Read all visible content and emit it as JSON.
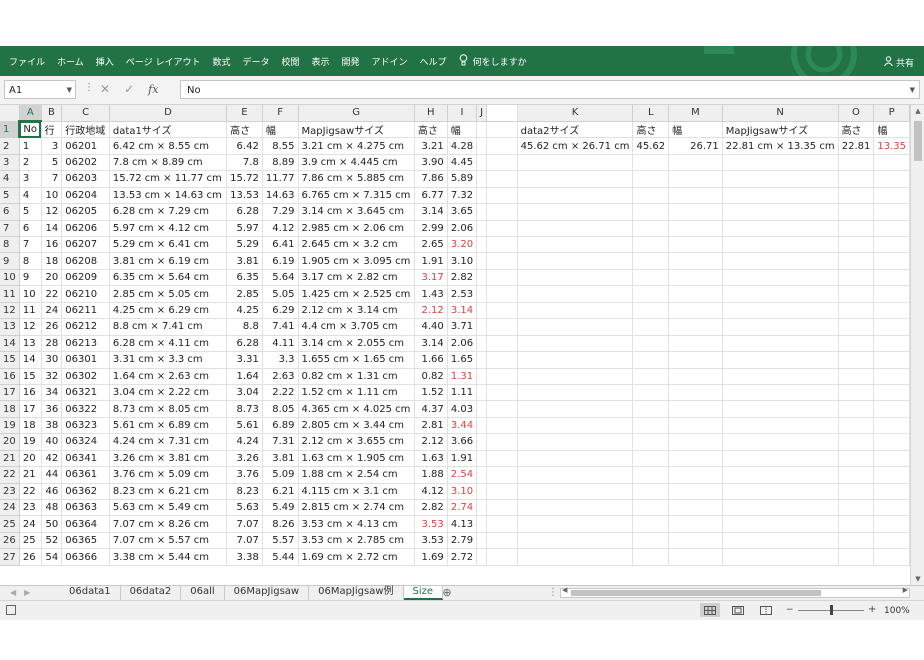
{
  "ribbon": {
    "tabs": [
      "ファイル",
      "ホーム",
      "挿入",
      "ページ レイアウト",
      "数式",
      "データ",
      "校閲",
      "表示",
      "開発",
      "アドイン",
      "ヘルプ"
    ],
    "tell_me": "何をしますか",
    "share": "共有"
  },
  "formula_bar": {
    "name_box": "A1",
    "fx": "fx",
    "content": "No"
  },
  "columns": [
    "A",
    "B",
    "C",
    "D",
    "E",
    "F",
    "G",
    "H",
    "I",
    "J",
    "K",
    "L",
    "M",
    "N",
    "O",
    "P"
  ],
  "header_row": [
    "No",
    "行",
    "行政地域",
    "data1サイズ",
    "高さ",
    "幅",
    "MapJigsawサイズ",
    "高さ",
    "幅",
    "",
    "data2サイズ",
    "高さ",
    "幅",
    "MapJigsawサイズ",
    "高さ",
    "幅"
  ],
  "rows": [
    [
      "1",
      "3",
      "06201",
      "6.42 cm × 8.55 cm",
      "6.42",
      "8.55",
      "3.21 cm × 4.275 cm",
      "3.21",
      "4.28",
      "",
      "45.62 cm × 26.71 cm",
      "45.62",
      "26.71",
      "22.81 cm × 13.35 cm",
      "22.81",
      "13.35"
    ],
    [
      "2",
      "5",
      "06202",
      "7.8 cm × 8.89 cm",
      "7.8",
      "8.89",
      "3.9 cm × 4.445 cm",
      "3.90",
      "4.45",
      "",
      "",
      "",
      "",
      "",
      "",
      ""
    ],
    [
      "3",
      "7",
      "06203",
      "15.72 cm × 11.77 cm",
      "15.72",
      "11.77",
      "7.86 cm × 5.885 cm",
      "7.86",
      "5.89",
      "",
      "",
      "",
      "",
      "",
      "",
      ""
    ],
    [
      "4",
      "10",
      "06204",
      "13.53 cm × 14.63 cm",
      "13.53",
      "14.63",
      "6.765 cm × 7.315 cm",
      "6.77",
      "7.32",
      "",
      "",
      "",
      "",
      "",
      "",
      ""
    ],
    [
      "5",
      "12",
      "06205",
      "6.28 cm × 7.29 cm",
      "6.28",
      "7.29",
      "3.14 cm × 3.645 cm",
      "3.14",
      "3.65",
      "",
      "",
      "",
      "",
      "",
      "",
      ""
    ],
    [
      "6",
      "14",
      "06206",
      "5.97 cm × 4.12 cm",
      "5.97",
      "4.12",
      "2.985 cm × 2.06 cm",
      "2.99",
      "2.06",
      "",
      "",
      "",
      "",
      "",
      "",
      ""
    ],
    [
      "7",
      "16",
      "06207",
      "5.29 cm × 6.41 cm",
      "5.29",
      "6.41",
      "2.645 cm × 3.2 cm",
      "2.65",
      "3.20",
      "",
      "",
      "",
      "",
      "",
      "",
      ""
    ],
    [
      "8",
      "18",
      "06208",
      "3.81 cm × 6.19 cm",
      "3.81",
      "6.19",
      "1.905 cm × 3.095 cm",
      "1.91",
      "3.10",
      "",
      "",
      "",
      "",
      "",
      "",
      ""
    ],
    [
      "9",
      "20",
      "06209",
      "6.35 cm × 5.64 cm",
      "6.35",
      "5.64",
      "3.17 cm × 2.82 cm",
      "3.17",
      "2.82",
      "",
      "",
      "",
      "",
      "",
      "",
      ""
    ],
    [
      "10",
      "22",
      "06210",
      "2.85 cm × 5.05 cm",
      "2.85",
      "5.05",
      "1.425 cm × 2.525 cm",
      "1.43",
      "2.53",
      "",
      "",
      "",
      "",
      "",
      "",
      ""
    ],
    [
      "11",
      "24",
      "06211",
      "4.25 cm × 6.29 cm",
      "4.25",
      "6.29",
      "2.12 cm × 3.14 cm",
      "2.12",
      "3.14",
      "",
      "",
      "",
      "",
      "",
      "",
      ""
    ],
    [
      "12",
      "26",
      "06212",
      "8.8 cm × 7.41 cm",
      "8.8",
      "7.41",
      "4.4 cm × 3.705 cm",
      "4.40",
      "3.71",
      "",
      "",
      "",
      "",
      "",
      "",
      ""
    ],
    [
      "13",
      "28",
      "06213",
      "6.28 cm × 4.11 cm",
      "6.28",
      "4.11",
      "3.14 cm × 2.055 cm",
      "3.14",
      "2.06",
      "",
      "",
      "",
      "",
      "",
      "",
      ""
    ],
    [
      "14",
      "30",
      "06301",
      "3.31 cm × 3.3 cm",
      "3.31",
      "3.3",
      "1.655 cm × 1.65 cm",
      "1.66",
      "1.65",
      "",
      "",
      "",
      "",
      "",
      "",
      ""
    ],
    [
      "15",
      "32",
      "06302",
      "1.64 cm × 2.63 cm",
      "1.64",
      "2.63",
      "0.82 cm × 1.31 cm",
      "0.82",
      "1.31",
      "",
      "",
      "",
      "",
      "",
      "",
      ""
    ],
    [
      "16",
      "34",
      "06321",
      "3.04 cm × 2.22 cm",
      "3.04",
      "2.22",
      "1.52 cm × 1.11 cm",
      "1.52",
      "1.11",
      "",
      "",
      "",
      "",
      "",
      "",
      ""
    ],
    [
      "17",
      "36",
      "06322",
      "8.73 cm × 8.05 cm",
      "8.73",
      "8.05",
      "4.365 cm × 4.025 cm",
      "4.37",
      "4.03",
      "",
      "",
      "",
      "",
      "",
      "",
      ""
    ],
    [
      "18",
      "38",
      "06323",
      "5.61 cm × 6.89 cm",
      "5.61",
      "6.89",
      "2.805 cm × 3.44 cm",
      "2.81",
      "3.44",
      "",
      "",
      "",
      "",
      "",
      "",
      ""
    ],
    [
      "19",
      "40",
      "06324",
      "4.24 cm × 7.31 cm",
      "4.24",
      "7.31",
      "2.12 cm × 3.655 cm",
      "2.12",
      "3.66",
      "",
      "",
      "",
      "",
      "",
      "",
      ""
    ],
    [
      "20",
      "42",
      "06341",
      "3.26 cm × 3.81 cm",
      "3.26",
      "3.81",
      "1.63 cm × 1.905 cm",
      "1.63",
      "1.91",
      "",
      "",
      "",
      "",
      "",
      "",
      ""
    ],
    [
      "21",
      "44",
      "06361",
      "3.76 cm × 5.09 cm",
      "3.76",
      "5.09",
      "1.88 cm × 2.54 cm",
      "1.88",
      "2.54",
      "",
      "",
      "",
      "",
      "",
      "",
      ""
    ],
    [
      "22",
      "46",
      "06362",
      "8.23 cm × 6.21 cm",
      "8.23",
      "6.21",
      "4.115 cm × 3.1 cm",
      "4.12",
      "3.10",
      "",
      "",
      "",
      "",
      "",
      "",
      ""
    ],
    [
      "23",
      "48",
      "06363",
      "5.63 cm × 5.49 cm",
      "5.63",
      "5.49",
      "2.815 cm × 2.74 cm",
      "2.82",
      "2.74",
      "",
      "",
      "",
      "",
      "",
      "",
      ""
    ],
    [
      "24",
      "50",
      "06364",
      "7.07 cm × 8.26 cm",
      "7.07",
      "8.26",
      "3.53 cm × 4.13 cm",
      "3.53",
      "4.13",
      "",
      "",
      "",
      "",
      "",
      "",
      ""
    ],
    [
      "25",
      "52",
      "06365",
      "7.07 cm × 5.57 cm",
      "7.07",
      "5.57",
      "3.53 cm × 2.785 cm",
      "3.53",
      "2.79",
      "",
      "",
      "",
      "",
      "",
      "",
      ""
    ],
    [
      "26",
      "54",
      "06366",
      "3.38 cm × 5.44 cm",
      "3.38",
      "5.44",
      "1.69 cm × 2.72 cm",
      "1.69",
      "2.72",
      "",
      "",
      "",
      "",
      "",
      "",
      ""
    ]
  ],
  "red_cells": [
    [
      1,
      15
    ],
    [
      7,
      8
    ],
    [
      9,
      7
    ],
    [
      11,
      7
    ],
    [
      11,
      8
    ],
    [
      15,
      8
    ],
    [
      18,
      8
    ],
    [
      21,
      8
    ],
    [
      22,
      8
    ],
    [
      23,
      8
    ],
    [
      24,
      7
    ]
  ],
  "sheet_tabs": [
    "06data1",
    "06data2",
    "06all",
    "06MapJigsaw",
    "06MapJigsaw例",
    "Size"
  ],
  "active_sheet": "Size",
  "status": {
    "zoom": "100%"
  },
  "colors": {
    "ribbon": "#217346",
    "red_value": "#e04040",
    "selection": "#217346"
  }
}
